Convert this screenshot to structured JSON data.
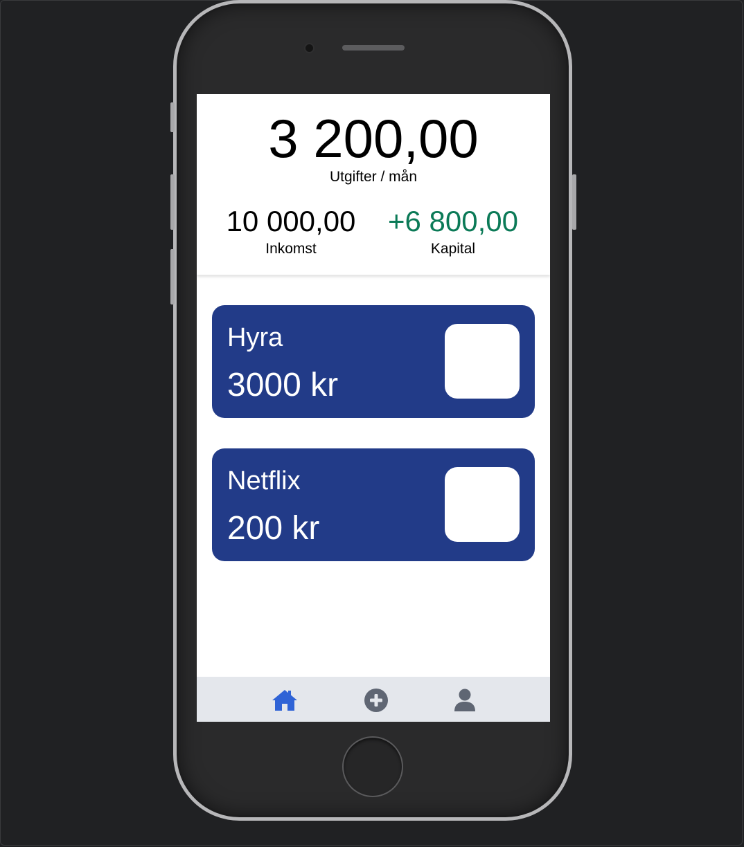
{
  "summary": {
    "expenses_value": "3 200,00",
    "expenses_label": "Utgifter / mån",
    "income_value": "10 000,00",
    "income_label": "Inkomst",
    "capital_value": "+6 800,00",
    "capital_label": "Kapital"
  },
  "expenses": [
    {
      "name": "Hyra",
      "amount": "3000 kr"
    },
    {
      "name": "Netflix",
      "amount": "200 kr"
    }
  ],
  "tabbar": {
    "items": [
      {
        "icon": "home-icon",
        "active": true
      },
      {
        "icon": "plus-circle-icon",
        "active": false
      },
      {
        "icon": "user-icon",
        "active": false
      }
    ]
  },
  "colors": {
    "card": "#223b88",
    "capital_positive": "#0b7a57",
    "tab_active": "#2f63d6",
    "tab_inactive": "#5f6673",
    "tabbar_bg": "#e4e7ec"
  }
}
